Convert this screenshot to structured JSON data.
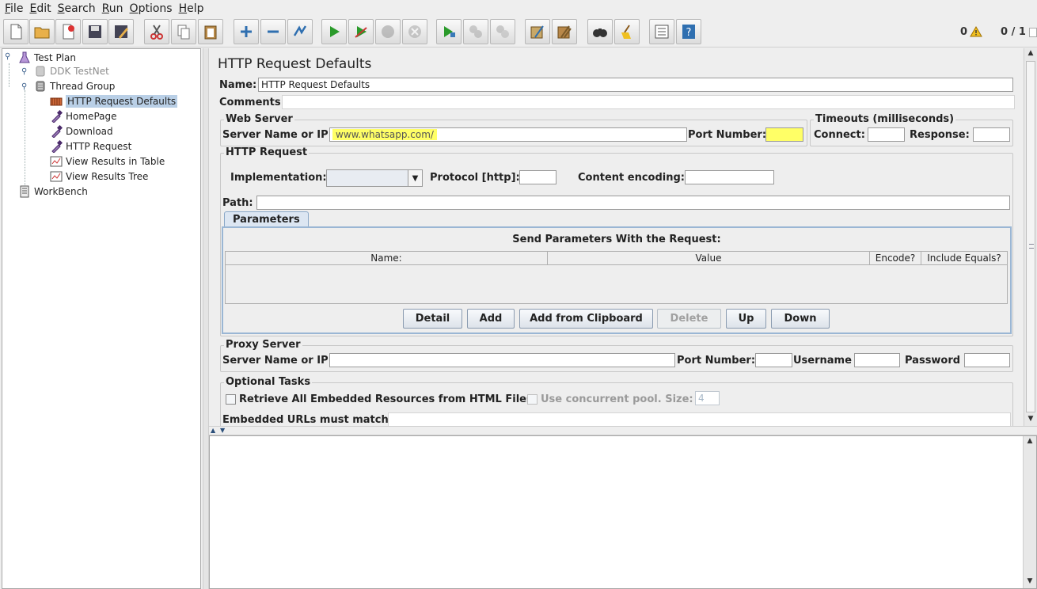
{
  "menu": {
    "file": {
      "mn": "F",
      "rest": "ile"
    },
    "edit": {
      "mn": "E",
      "rest": "dit"
    },
    "search": {
      "mn": "S",
      "rest": "earch"
    },
    "run": {
      "mn": "R",
      "rest": "un"
    },
    "options": {
      "mn": "O",
      "rest": "ptions"
    },
    "help": {
      "mn": "H",
      "rest": "elp"
    }
  },
  "toolbar": {
    "error_count": "0",
    "thread_count": "0 / 1"
  },
  "tree": {
    "test_plan": "Test Plan",
    "ddk_testnet": "DDK TestNet",
    "thread_group": "Thread Group",
    "http_request_defaults": "HTTP Request Defaults",
    "homepage": "HomePage",
    "download": "Download",
    "http_request": "HTTP Request",
    "view_results_table": "View Results in Table",
    "view_results_tree": "View Results Tree",
    "workbench": "WorkBench"
  },
  "form": {
    "title": "HTTP Request Defaults",
    "name_label": "Name:",
    "name_value": "HTTP Request Defaults",
    "comments_label": "Comments:",
    "comments_value": "",
    "web_server": {
      "title": "Web Server",
      "server_label": "Server Name or IP:",
      "server_value": "www.whatsapp.com/",
      "port_label": "Port Number:",
      "port_value": ""
    },
    "timeouts": {
      "title": "Timeouts (milliseconds)",
      "connect_label": "Connect:",
      "connect_value": "",
      "response_label": "Response:",
      "response_value": ""
    },
    "http_request": {
      "title": "HTTP Request",
      "implementation_label": "Implementation:",
      "implementation_value": "",
      "protocol_label": "Protocol [http]:",
      "protocol_value": "",
      "encoding_label": "Content encoding:",
      "encoding_value": "",
      "path_label": "Path:",
      "path_value": ""
    },
    "parameters": {
      "tab_label": "Parameters",
      "heading": "Send Parameters With the Request:",
      "columns": [
        "Name:",
        "Value",
        "Encode?",
        "Include Equals?"
      ],
      "rows": [],
      "buttons": {
        "detail": "Detail",
        "add": "Add",
        "add_clipboard": "Add from Clipboard",
        "delete": "Delete",
        "up": "Up",
        "down": "Down"
      }
    },
    "proxy": {
      "title": "Proxy Server",
      "server_label": "Server Name or IP:",
      "server_value": "",
      "port_label": "Port Number:",
      "port_value": "",
      "username_label": "Username",
      "username_value": "",
      "password_label": "Password",
      "password_value": ""
    },
    "optional": {
      "title": "Optional Tasks",
      "retrieve_label": "Retrieve All Embedded Resources from HTML Files",
      "retrieve_checked": false,
      "concurrent_label": "Use concurrent pool. Size:",
      "concurrent_checked": false,
      "pool_size": "4",
      "embedded_label": "Embedded URLs must match:",
      "embedded_value": ""
    }
  },
  "colors": {
    "highlight": "#ffff66",
    "selection": "#b9cfe6",
    "accent": "#2f6fb0"
  }
}
